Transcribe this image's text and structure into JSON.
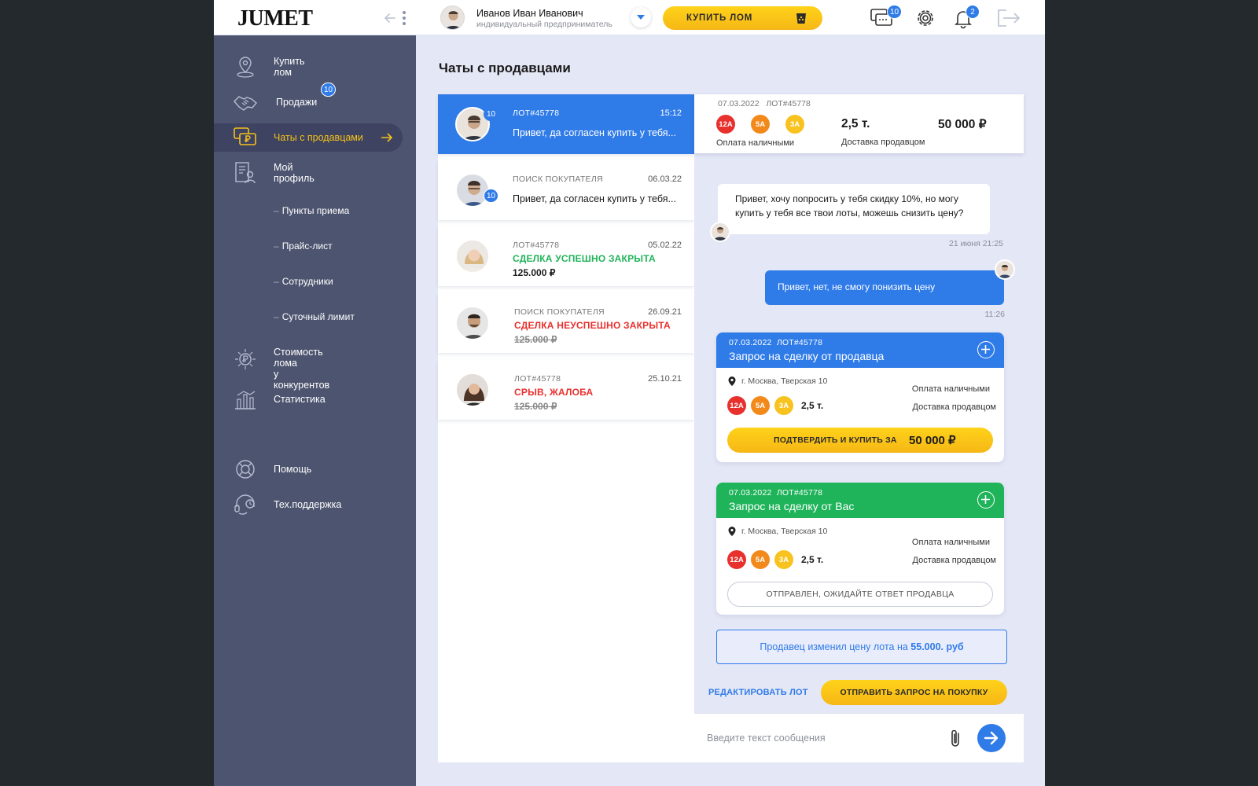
{
  "brand": {
    "logo": "JUMET"
  },
  "header": {
    "user_name": "Иванов Иван Иванович",
    "user_role": "индивидуальный предприниматель",
    "buy_button": "КУПИТЬ ЛОМ",
    "chats_badge": "10",
    "notifications_badge": "2",
    "icons": [
      "collapse-icon",
      "chevron-down-icon",
      "scrap-bin-icon",
      "chat-icon",
      "gear-icon",
      "bell-icon",
      "logout-icon"
    ]
  },
  "sidebar": {
    "items": [
      {
        "label": "Купить лом",
        "icon": "map-pin-icon"
      },
      {
        "label": "Продажи",
        "icon": "handshake-icon",
        "badge": "10"
      },
      {
        "label": "Чаты с продавцами",
        "icon": "chat-ruble-icon",
        "active": true
      },
      {
        "label": "Мой профиль",
        "icon": "profile-icon"
      },
      {
        "label": "Стоимость лома\nу конкурентов",
        "line1": "Стоимость лома",
        "line2": "у конкурентов",
        "icon": "ruble-sun-icon"
      },
      {
        "label": "Статистика",
        "icon": "statistics-icon"
      },
      {
        "label": "Помощь",
        "icon": "lifebuoy-icon"
      },
      {
        "label": "Тех.поддержка",
        "icon": "headset-icon"
      }
    ],
    "subitems": [
      "Пункты приема",
      "Прайс-лист",
      "Сотрудники",
      "Суточный лимит"
    ],
    "dash": "–"
  },
  "page": {
    "title": "Чаты с продавцами"
  },
  "chats": [
    {
      "meta": "ЛОТ#45778",
      "date": "15:12",
      "message": "Привет, да согласен купить у тебя...",
      "badge": "10",
      "selected": true
    },
    {
      "meta": "ПОИСК ПОКУПАТЕЛЯ",
      "date": "06.03.22",
      "message": "Привет, да согласен купить у тебя...",
      "badge": "10"
    },
    {
      "meta": "ЛОТ#45778",
      "date": "05.02.22",
      "status": "СДЕЛКА УСПЕШНО ЗАКРЫТА",
      "status_color": "#1fb45a",
      "price": "125.000 ₽"
    },
    {
      "meta": "ПОИСК ПОКУПАТЕЛЯ",
      "date": "26.09.21",
      "status": "СДЕЛКА НЕУСПЕШНО ЗАКРЫТА",
      "status_color": "#e8302d",
      "price": "125.000 ₽"
    },
    {
      "meta": "ЛОТ#45778",
      "date": "25.10.21",
      "status": "СРЫВ, ЖАЛОБА",
      "status_color": "#e8302d",
      "price": "125.000 ₽"
    }
  ],
  "lot_header": {
    "date": "07.03.2022",
    "lot": "ЛОТ#45778",
    "chips": [
      "12А",
      "5А",
      "3А"
    ],
    "payment": "Оплата наличными",
    "weight": "2,5 т.",
    "delivery": "Доставка продавцом",
    "price": "50 000 ₽"
  },
  "messages": [
    {
      "text": "Привет, хочу попросить у тебя скидку 10%, но могу купить у тебя все твои лоты, можешь снизить цену?",
      "time": "21 июня 21:25",
      "from": "seller"
    },
    {
      "text": "Привет, нет, не смогу понизить цену",
      "time": "11:26",
      "from": "me"
    }
  ],
  "deal_cards": [
    {
      "date": "07.03.2022",
      "lot": "ЛОТ#45778",
      "title": "Запрос на сделку от продавца",
      "color": "#2f7be8",
      "address": "г. Москва, Тверская 10",
      "chips": [
        "12А",
        "5А",
        "3А"
      ],
      "weight": "2,5 т.",
      "payment": "Оплата наличными",
      "delivery": "Доставка продавцом",
      "action_label": "ПОДТВЕРДИТЬ И КУПИТЬ ЗА",
      "action_price": "50 000 ₽"
    },
    {
      "date": "07.03.2022",
      "lot": "ЛОТ#45778",
      "title": "Запрос на сделку от Вас",
      "color": "#1fb45a",
      "address": "г. Москва, Тверская 10",
      "chips": [
        "12А",
        "5А",
        "3А"
      ],
      "weight": "2,5 т.",
      "payment": "Оплата наличными",
      "delivery": "Доставка продавцом",
      "status": "ОТПРАВЛЕН, ОЖИДАЙТЕ ОТВЕТ ПРОДАВЦА"
    }
  ],
  "notice": {
    "text": "Продавец изменил цену лота на",
    "value": "55.000. руб"
  },
  "actions": {
    "edit_lot": "РЕДАКТИРОВАТЬ ЛОТ",
    "send_request": "ОТПРАВИТЬ ЗАПРОС НА ПОКУПКУ"
  },
  "composer": {
    "placeholder": "Введите текст сообщения",
    "value": ""
  },
  "colors": {
    "accent": "#2f7be8",
    "yellow": "#f8c21f",
    "green": "#1fb45a",
    "red": "#e8302d",
    "sidebar": "#4d546f"
  }
}
